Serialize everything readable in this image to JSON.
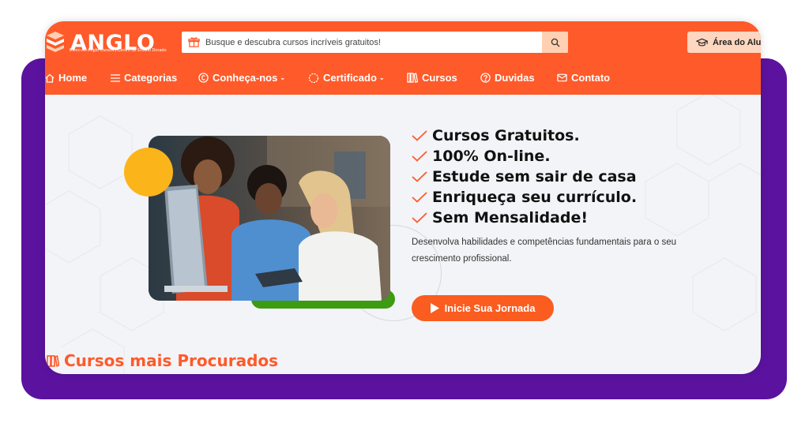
{
  "brand": {
    "name": "ANGLO",
    "tagline": "Elevo Ao Anglo Cursos | Centro de Ensino Dorado",
    "primary_color": "#ff5a2a",
    "accent_purple": "#5b139f"
  },
  "header": {
    "search": {
      "placeholder": "Busque e descubra cursos incríveis gratuitos!",
      "value": ""
    },
    "student_area_label": "Área do Aluno"
  },
  "nav": {
    "items": [
      {
        "label": "Home",
        "icon": "home-icon"
      },
      {
        "label": "Categorias",
        "icon": "menu-icon"
      },
      {
        "label": "Conheça-nos",
        "icon": "copyright-icon",
        "has_dropdown": true
      },
      {
        "label": "Certificado",
        "icon": "certificate-icon",
        "has_dropdown": true
      },
      {
        "label": "Cursos",
        "icon": "books-icon"
      },
      {
        "label": "Duvidas",
        "icon": "question-icon"
      },
      {
        "label": "Contato",
        "icon": "mail-icon"
      }
    ]
  },
  "hero": {
    "features": [
      "Cursos Gratuitos.",
      "100% On-line.",
      "Estude sem sair de casa",
      "Enriqueça seu currículo.",
      "Sem Mensalidade!"
    ],
    "description": "Desenvolva habilidades e competências fundamentais para o seu crescimento profissional.",
    "cta_label": "Inicie Sua Jornada"
  },
  "section": {
    "title": "Cursos mais Procurados"
  }
}
